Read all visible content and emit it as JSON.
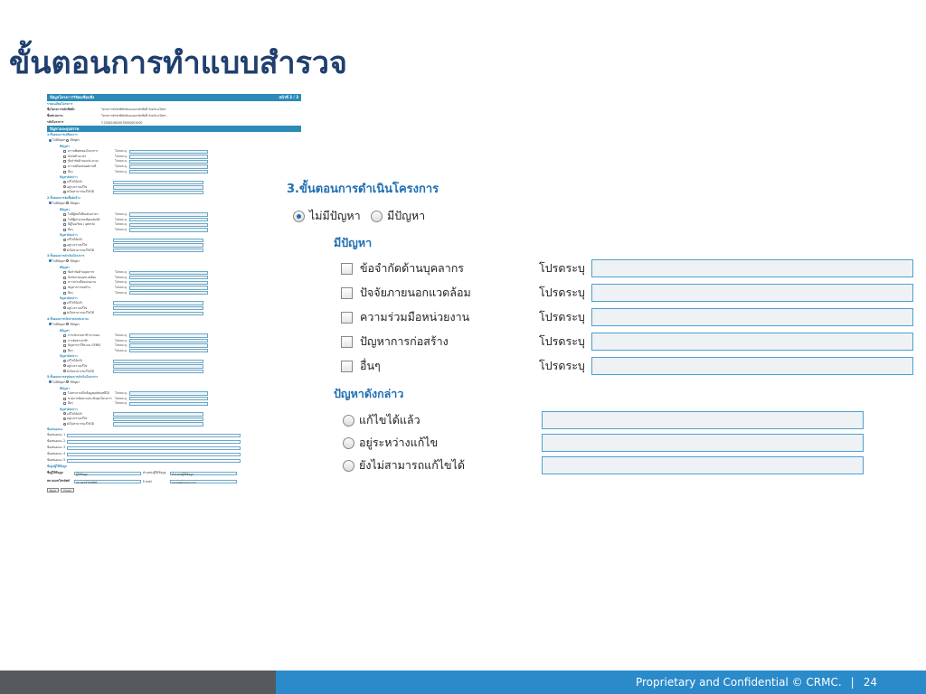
{
  "slide": {
    "title": "ขั้นตอนการทำแบบสำรวจ"
  },
  "form": {
    "section_title": "3.ขั้นตอนการดำเนินโครงการ",
    "options": {
      "no_problem": "ไม่มีปัญหา",
      "has_problem": "มีปัญหา",
      "selected": "no_problem"
    },
    "problems_heading": "มีปัญหา",
    "problems": [
      {
        "label": "ข้อจำกัดด้านบุคลากร",
        "specify": "โปรดระบุ"
      },
      {
        "label": "ปัจจัยภายนอกแวดล้อม",
        "specify": "โปรดระบุ"
      },
      {
        "label": "ความร่วมมือหน่วยงาน",
        "specify": "โปรดระบุ"
      },
      {
        "label": "ปัญหาการก่อสร้าง",
        "specify": "โปรดระบุ"
      },
      {
        "label": "อื่นๆ",
        "specify": "โปรดระบุ"
      }
    ],
    "resolution_heading": "ปัญหาดังกล่าว",
    "resolutions": [
      {
        "label": "แก้ไขได้แล้ว"
      },
      {
        "label": "อยู่ระหว่างแก้ไข"
      },
      {
        "label": "ยังไม่สามารถแก้ไขได้"
      }
    ]
  },
  "thumbnail": {
    "header_left": "ข้อมูลโครงการวิจัยบเขียนสิ่ง",
    "header_right": "หน้าที่ 3 / 3",
    "general_heading": "รายละเอียดโครงการ",
    "info": [
      {
        "k": "ชื่อโครงการหลักชีพสิ่ง",
        "v": "โครงการสำนักพิทักษ์และเยอรมัภสิทธิ์ จังหวัด ยโสธร"
      },
      {
        "k": "ชื่อหน่วยงาน",
        "v": "โครงการสำนักพิทักษ์และเยอรมัภสิทธิ์ จังหวัด ยโสธร"
      },
      {
        "k": "รหัสโครงการ",
        "v": "T-250010620070000001000"
      }
    ],
    "problem_bar": "ปัญหาและอุปสรรค",
    "groups": [
      {
        "title": "1.ขั้นตอนการเตรียมการ",
        "items": [
          "ความพิเศษของโครงการ",
          "ปัจจัยด้านเวลา",
          "ข้อจำกัดด้านงบประมาณ",
          "ความพร้อมของสถานที่",
          "อื่นๆ"
        ]
      },
      {
        "title": "2.ขั้นตอนการจัดซื้อจัดจ้าง",
        "items": [
          "ไม่มีผู้สนใจยื่นเสนอราคา",
          "ไม่มีผู้ผ่านเกณฑ์คุณสมบัติ",
          "มีผู้ร้องเรียน / อุทธรณ์",
          "อื่นๆ"
        ]
      },
      {
        "title": "3.ขั้นตอนการดำเนินโครงการ",
        "items": [
          "ข้อจำกัดด้านบุคลากร",
          "ปัจจัยภายนอกแวดล้อม",
          "ความร่วมมือหน่วยงาน",
          "ปัญหาการก่อสร้าง",
          "อื่นๆ"
        ]
      },
      {
        "title": "4.ขั้นตอนการเบิกจ่ายงบประมาณ",
        "items": [
          "การเบิกจ่ายล่าช้ากว่าแผน",
          "การจัดสรรล่าช้า",
          "ปัญหาการใช้ระบบ GFMIS",
          "อื่นๆ"
        ]
      },
      {
        "title": "5.ขั้นตอนการสรุปผลการดำเนินโครงการ",
        "items": [
          "ไม่สามารถเก็บข้อมูลผลสัมฤทธิ์ได้",
          "ขาดการติดตามประเมินผลโครงการ",
          "อื่นๆ"
        ]
      }
    ],
    "suggest_heading": "ข้อเสนอแนะ",
    "suggestions": [
      "ข้อเสนอแนะ 1",
      "ข้อเสนอแนะ 2",
      "ข้อเสนอแนะ 3",
      "ข้อเสนอแนะ 4",
      "ข้อเสนอแนะ 5"
    ],
    "contact_heading": "ข้อมูลผู้ให้ข้อมูล",
    "contact": [
      {
        "k": "ชื่อผู้ให้ข้อมูล",
        "v": "ผู้ให้ข้อมูล",
        "k2": "ตำแหน่งผู้ให้ข้อมูล",
        "v2": "ตำแหน่งผู้ให้ข้อมูล"
      },
      {
        "k": "หมายเลขโทรศัพท์",
        "v": "หมายเลขโทรศัพท์",
        "k2": "E-mail",
        "v2": "email@email.com"
      }
    ],
    "buttons": [
      "Back",
      "Finish"
    ]
  },
  "footer": {
    "text": "Proprietary and Confidential © CRMC.",
    "separator": "|",
    "page": "24"
  },
  "colors": {
    "accent": "#1f6fb3",
    "footer_blue": "#2b8ac9",
    "footer_dark": "#555a5e",
    "title": "#1f3f6e"
  }
}
